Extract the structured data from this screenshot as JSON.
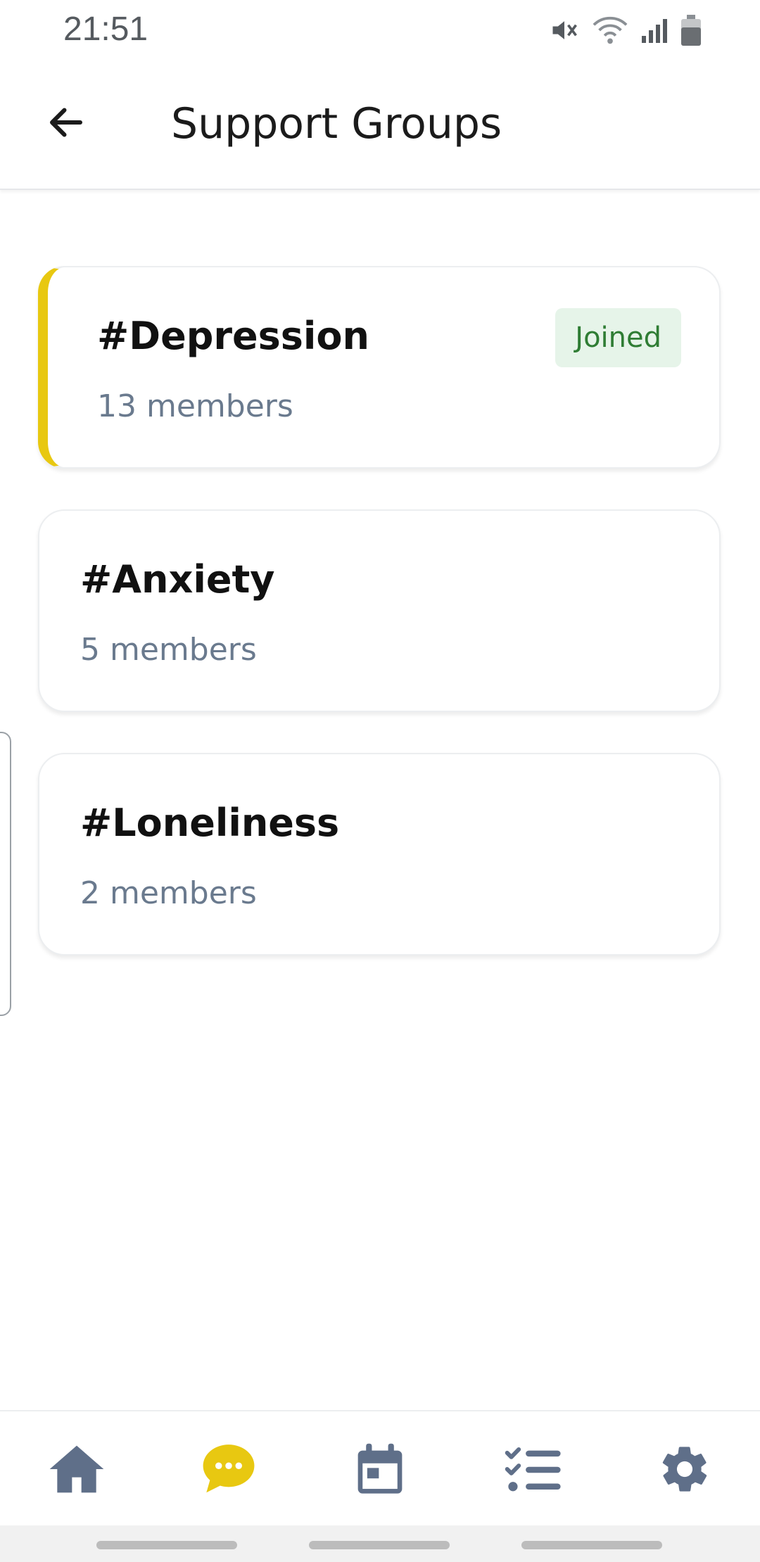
{
  "status_bar": {
    "time": "21:51",
    "icons": [
      "mute-icon",
      "wifi-icon",
      "signal-icon",
      "battery-icon"
    ]
  },
  "header": {
    "title": "Support Groups",
    "back_icon": "arrow-left-icon"
  },
  "groups": [
    {
      "name": "#Depression",
      "members": "13 members",
      "joined": true,
      "badge": "Joined"
    },
    {
      "name": "#Anxiety",
      "members": "5 members",
      "joined": false
    },
    {
      "name": "#Loneliness",
      "members": "2 members",
      "joined": false
    }
  ],
  "bottom_nav": {
    "items": [
      {
        "icon": "home-icon",
        "active": false
      },
      {
        "icon": "chat-bubble-icon",
        "active": true
      },
      {
        "icon": "calendar-icon",
        "active": false
      },
      {
        "icon": "checklist-icon",
        "active": false
      },
      {
        "icon": "gear-icon",
        "active": false
      }
    ]
  },
  "colors": {
    "accent": "#e8c811",
    "nav_icon": "#5f6f89",
    "joined_badge_bg": "#e6f4e9",
    "joined_badge_text": "#2f7d34",
    "member_text": "#6a7a8e"
  }
}
